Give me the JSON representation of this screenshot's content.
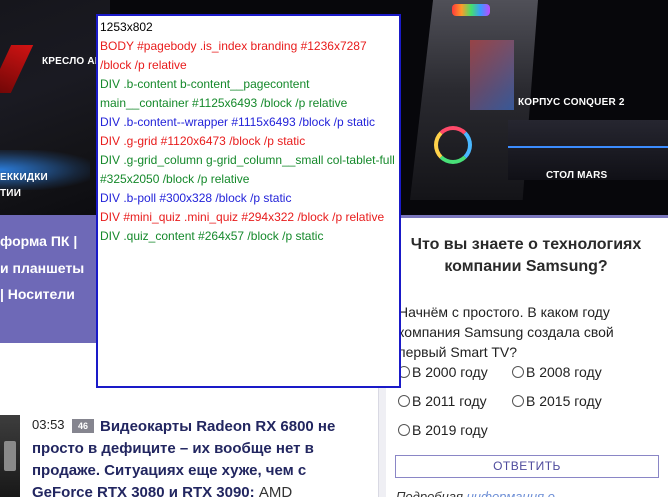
{
  "banner": {
    "label_chair": "КРЕСЛО AR",
    "label_case": "КОРПУС CONQUER 2",
    "label_desk": "СТОЛ MARS",
    "label_left_1": "ЕККИДКИ",
    "label_left_2": "ТИИ"
  },
  "left_nav": {
    "row1": "форма ПК |",
    "row2": "и планшеты",
    "row3": "|  Носители"
  },
  "news": {
    "time": "03:53",
    "comments": "46",
    "headline": "Видеокарты Radeon RX 6800 не просто в дефиците – их вообще нет в продаже. Ситуациях еще хуже, чем с GeForce RTX 3080 и RTX 3090:",
    "source": "AMD"
  },
  "poll": {
    "title": "Что вы знаете о технологиях компании Samsung?",
    "question": "Начнём с простого. В каком году компания Samsung создала свой первый Smart TV?",
    "options": [
      "В 2000 году",
      "В 2008 году",
      "В 2011 году",
      "В 2015 году",
      "В 2019 году"
    ],
    "submit": "ОТВЕТИТЬ",
    "more_prefix": "Подробная",
    "more_link": "информация о"
  },
  "inspector": {
    "lines": [
      "1253x802",
      "BODY #pagebody .is_index branding #1236x7287 /block /p relative",
      "DIV .b-content b-content__pagecontent main__container #1125x6493 /block /p relative",
      "DIV .b-content--wrapper #1115x6493 /block /p static",
      "DIV .g-grid #1120x6473 /block /p static",
      "DIV .g-grid_column g-grid_column__small col-tablet-full #325x2050 /block /p relative",
      "DIV .b-poll #300x328 /block /p static",
      "DIV #mini_quiz .mini_quiz #294x322 /block /p relative",
      "DIV .quiz_content #264x57 /block /p static"
    ]
  }
}
